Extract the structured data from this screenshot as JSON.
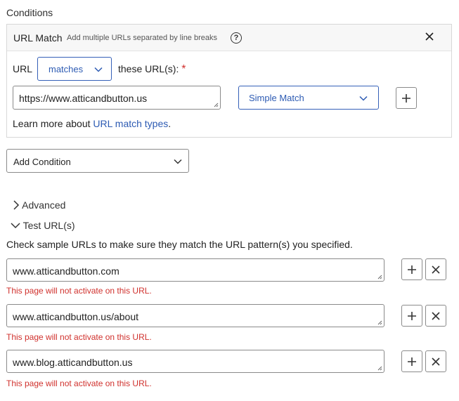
{
  "conditions_title": "Conditions",
  "url_match": {
    "title": "URL Match",
    "subtitle": "Add multiple URLs separated by line breaks",
    "help_glyph": "?",
    "help_icon": "question-circle-icon",
    "close_icon": "close-icon",
    "url_label": "URL",
    "operator_value": "matches",
    "these_urls_label": "these URL(s):",
    "required_mark": "*",
    "url_value": "https://www.atticandbutton.us",
    "match_type_value": "Simple Match",
    "learn_more_prefix": "Learn more about ",
    "learn_more_link": "URL match types",
    "learn_more_suffix": "."
  },
  "add_condition": {
    "value": "Add Condition"
  },
  "advanced": {
    "label": "Advanced"
  },
  "test_urls": {
    "label": "Test URL(s)",
    "description": "Check sample URLs to make sure they match the URL pattern(s) you specified.",
    "items": [
      {
        "value": "www.atticandbutton.com",
        "message": "This page will not activate on this URL."
      },
      {
        "value": "www.atticandbutton.us/about",
        "message": "This page will not activate on this URL."
      },
      {
        "value": "www.blog.atticandbutton.us",
        "message": "This page will not activate on this URL."
      }
    ]
  },
  "colors": {
    "accent_blue": "#2d5bb3",
    "error_red": "#d0312d",
    "panel_header_bg": "#f7f7f7"
  }
}
